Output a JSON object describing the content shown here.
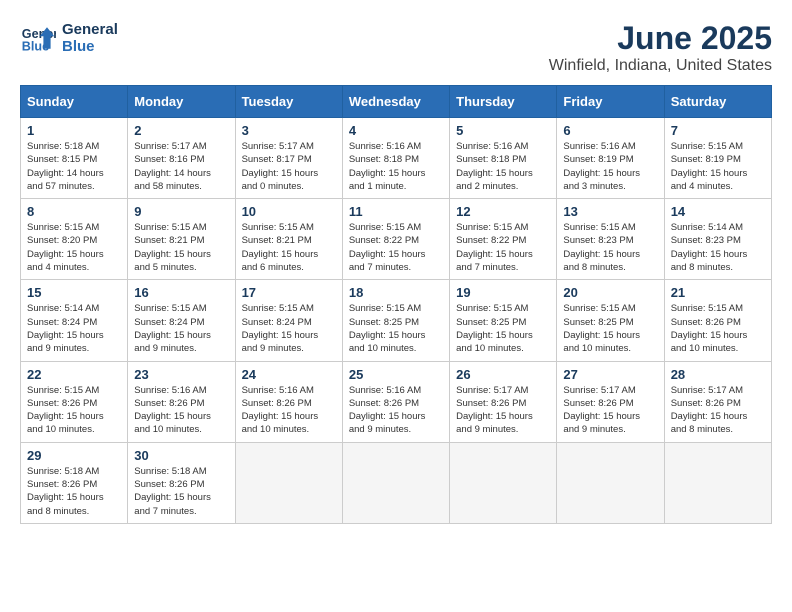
{
  "header": {
    "logo_line1": "General",
    "logo_line2": "Blue",
    "title": "June 2025",
    "subtitle": "Winfield, Indiana, United States"
  },
  "calendar": {
    "headers": [
      "Sunday",
      "Monday",
      "Tuesday",
      "Wednesday",
      "Thursday",
      "Friday",
      "Saturday"
    ],
    "weeks": [
      [
        {
          "day": "",
          "info": ""
        },
        {
          "day": "2",
          "info": "Sunrise: 5:17 AM\nSunset: 8:16 PM\nDaylight: 14 hours\nand 58 minutes."
        },
        {
          "day": "3",
          "info": "Sunrise: 5:17 AM\nSunset: 8:17 PM\nDaylight: 15 hours\nand 0 minutes."
        },
        {
          "day": "4",
          "info": "Sunrise: 5:16 AM\nSunset: 8:18 PM\nDaylight: 15 hours\nand 1 minute."
        },
        {
          "day": "5",
          "info": "Sunrise: 5:16 AM\nSunset: 8:18 PM\nDaylight: 15 hours\nand 2 minutes."
        },
        {
          "day": "6",
          "info": "Sunrise: 5:16 AM\nSunset: 8:19 PM\nDaylight: 15 hours\nand 3 minutes."
        },
        {
          "day": "7",
          "info": "Sunrise: 5:15 AM\nSunset: 8:19 PM\nDaylight: 15 hours\nand 4 minutes."
        }
      ],
      [
        {
          "day": "1",
          "info": "Sunrise: 5:18 AM\nSunset: 8:15 PM\nDaylight: 14 hours\nand 57 minutes."
        },
        null,
        null,
        null,
        null,
        null,
        null
      ],
      [
        {
          "day": "8",
          "info": "Sunrise: 5:15 AM\nSunset: 8:20 PM\nDaylight: 15 hours\nand 4 minutes."
        },
        {
          "day": "9",
          "info": "Sunrise: 5:15 AM\nSunset: 8:21 PM\nDaylight: 15 hours\nand 5 minutes."
        },
        {
          "day": "10",
          "info": "Sunrise: 5:15 AM\nSunset: 8:21 PM\nDaylight: 15 hours\nand 6 minutes."
        },
        {
          "day": "11",
          "info": "Sunrise: 5:15 AM\nSunset: 8:22 PM\nDaylight: 15 hours\nand 7 minutes."
        },
        {
          "day": "12",
          "info": "Sunrise: 5:15 AM\nSunset: 8:22 PM\nDaylight: 15 hours\nand 7 minutes."
        },
        {
          "day": "13",
          "info": "Sunrise: 5:15 AM\nSunset: 8:23 PM\nDaylight: 15 hours\nand 8 minutes."
        },
        {
          "day": "14",
          "info": "Sunrise: 5:14 AM\nSunset: 8:23 PM\nDaylight: 15 hours\nand 8 minutes."
        }
      ],
      [
        {
          "day": "15",
          "info": "Sunrise: 5:14 AM\nSunset: 8:24 PM\nDaylight: 15 hours\nand 9 minutes."
        },
        {
          "day": "16",
          "info": "Sunrise: 5:15 AM\nSunset: 8:24 PM\nDaylight: 15 hours\nand 9 minutes."
        },
        {
          "day": "17",
          "info": "Sunrise: 5:15 AM\nSunset: 8:24 PM\nDaylight: 15 hours\nand 9 minutes."
        },
        {
          "day": "18",
          "info": "Sunrise: 5:15 AM\nSunset: 8:25 PM\nDaylight: 15 hours\nand 10 minutes."
        },
        {
          "day": "19",
          "info": "Sunrise: 5:15 AM\nSunset: 8:25 PM\nDaylight: 15 hours\nand 10 minutes."
        },
        {
          "day": "20",
          "info": "Sunrise: 5:15 AM\nSunset: 8:25 PM\nDaylight: 15 hours\nand 10 minutes."
        },
        {
          "day": "21",
          "info": "Sunrise: 5:15 AM\nSunset: 8:26 PM\nDaylight: 15 hours\nand 10 minutes."
        }
      ],
      [
        {
          "day": "22",
          "info": "Sunrise: 5:15 AM\nSunset: 8:26 PM\nDaylight: 15 hours\nand 10 minutes."
        },
        {
          "day": "23",
          "info": "Sunrise: 5:16 AM\nSunset: 8:26 PM\nDaylight: 15 hours\nand 10 minutes."
        },
        {
          "day": "24",
          "info": "Sunrise: 5:16 AM\nSunset: 8:26 PM\nDaylight: 15 hours\nand 10 minutes."
        },
        {
          "day": "25",
          "info": "Sunrise: 5:16 AM\nSunset: 8:26 PM\nDaylight: 15 hours\nand 9 minutes."
        },
        {
          "day": "26",
          "info": "Sunrise: 5:17 AM\nSunset: 8:26 PM\nDaylight: 15 hours\nand 9 minutes."
        },
        {
          "day": "27",
          "info": "Sunrise: 5:17 AM\nSunset: 8:26 PM\nDaylight: 15 hours\nand 9 minutes."
        },
        {
          "day": "28",
          "info": "Sunrise: 5:17 AM\nSunset: 8:26 PM\nDaylight: 15 hours\nand 8 minutes."
        }
      ],
      [
        {
          "day": "29",
          "info": "Sunrise: 5:18 AM\nSunset: 8:26 PM\nDaylight: 15 hours\nand 8 minutes."
        },
        {
          "day": "30",
          "info": "Sunrise: 5:18 AM\nSunset: 8:26 PM\nDaylight: 15 hours\nand 7 minutes."
        },
        {
          "day": "",
          "info": ""
        },
        {
          "day": "",
          "info": ""
        },
        {
          "day": "",
          "info": ""
        },
        {
          "day": "",
          "info": ""
        },
        {
          "day": "",
          "info": ""
        }
      ]
    ]
  }
}
